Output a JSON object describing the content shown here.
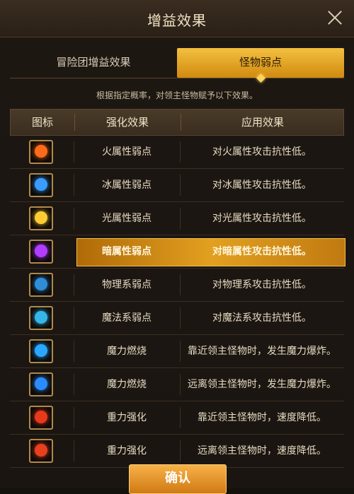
{
  "dialog": {
    "title": "增益效果"
  },
  "tabs": [
    {
      "label": "冒险团增益效果",
      "active": false
    },
    {
      "label": "怪物弱点",
      "active": true
    }
  ],
  "description": "根据指定概率，对领主怪物赋予以下效果。",
  "table": {
    "headers": [
      "图标",
      "强化效果",
      "应用效果"
    ],
    "rows": [
      {
        "icon": "fire-weakness-icon",
        "color": "#ff6a1a",
        "effect": "火属性弱点",
        "applied": "对火属性攻击抗性低。",
        "highlight": false
      },
      {
        "icon": "ice-weakness-icon",
        "color": "#3a9cff",
        "effect": "冰属性弱点",
        "applied": "对冰属性攻击抗性低。",
        "highlight": false
      },
      {
        "icon": "light-weakness-icon",
        "color": "#ffcc33",
        "effect": "光属性弱点",
        "applied": "对光属性攻击抗性低。",
        "highlight": false
      },
      {
        "icon": "dark-weakness-icon",
        "color": "#b23cff",
        "effect": "暗属性弱点",
        "applied": "对暗属性攻击抗性低。",
        "highlight": true
      },
      {
        "icon": "physical-weakness-icon",
        "color": "#2e8ed8",
        "effect": "物理系弱点",
        "applied": "对物理系攻击抗性低。",
        "highlight": false
      },
      {
        "icon": "magic-weakness-icon",
        "color": "#36b6e8",
        "effect": "魔法系弱点",
        "applied": "对魔法系攻击抗性低。",
        "highlight": false
      },
      {
        "icon": "mana-burn-near-icon",
        "color": "#2aa8ff",
        "effect": "魔力燃烧",
        "applied": "靠近领主怪物时，发生魔力爆炸。",
        "highlight": false
      },
      {
        "icon": "mana-burn-far-icon",
        "color": "#2a8cff",
        "effect": "魔力燃烧",
        "applied": "远离领主怪物时，发生魔力爆炸。",
        "highlight": false
      },
      {
        "icon": "gravity-near-icon",
        "color": "#e83a1a",
        "effect": "重力强化",
        "applied": "靠近领主怪物时，速度降低。",
        "highlight": false
      },
      {
        "icon": "gravity-far-icon",
        "color": "#e8401e",
        "effect": "重力强化",
        "applied": "远离领主怪物时，速度降低。",
        "highlight": false
      }
    ]
  },
  "confirm_label": "确认"
}
